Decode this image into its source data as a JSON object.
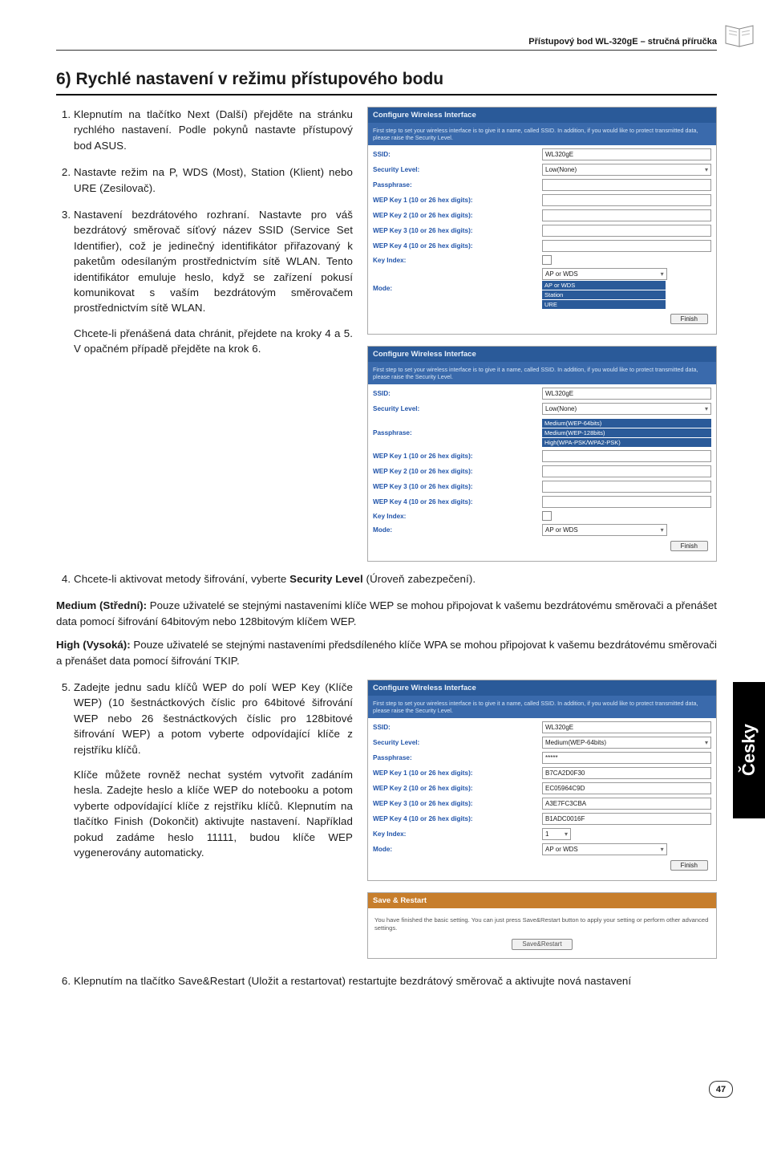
{
  "header": {
    "product": "Přístupový bod WL-320gE – stručná příručka"
  },
  "section": {
    "title": "6) Rychlé nastavení v režimu přístupového bodu"
  },
  "list": {
    "i1": "Klepnutím na tlačítko Next (Další) přejděte na stránku rychlého nastavení. Podle pokynů nastavte přístupový bod ASUS.",
    "i2": "Nastavte režim na P, WDS (Most), Station (Klient) nebo URE (Zesilovač).",
    "i3a": "Nastavení bezdrátového rozhraní. Nastavte pro váš bezdrátový směrovač síťový název SSID (Service Set Identifier), což je jedinečný identifikátor přiřazovaný k paketům odesílaným prostřednictvím sítě WLAN. Tento identifikátor emuluje heslo, když se zařízení pokusí komunikovat s vaším bezdrátovým směrovačem prostřednictvím sítě WLAN.",
    "i3b": "Chcete-li přenášená data chránit, přejdete na kroky 4 a 5. V opačném případě přejděte na krok 6.",
    "i4a": "Chcete-li aktivovat metody šifrování, vyberte ",
    "i4b": "Security Level",
    "i4c": " (Úroveň zabezpečení).",
    "i5a": "Zadejte jednu sadu klíčů WEP do polí WEP Key (Klíče WEP) (10 šestnáctkových číslic pro 64bitové šifrování WEP nebo 26 šestnáctkových číslic pro 128bitové šifrování WEP) a potom vyberte odpovídající klíče z rejstříku klíčů.",
    "i5b": "Klíče můžete rovněž nechat systém vytvořit zadáním hesla. Zadejte heslo a klíče WEP do notebooku a potom vyberte odpovídající klíče z rejstříku klíčů. Klepnutím na tlačítko Finish (Dokončit) aktivujte nastavení. Například pokud zadáme heslo 11111, budou klíče WEP vygenerovány automaticky.",
    "i6": "Klepnutím na tlačítko Save&Restart (Uložit a restartovat) restartujte bezdrátový směrovač a aktivujte nová nastavení"
  },
  "medium": {
    "label": "Medium (Střední):",
    "text": " Pouze uživatelé se stejnými nastaveními klíče WEP se mohou připojovat k vašemu bezdrátovému směrovači a přenášet data pomocí šifrování 64bitovým nebo 128bitovým klíčem WEP."
  },
  "high": {
    "label": "High (Vysoká):",
    "text": " Pouze uživatelé se stejnými nastaveními předsdíleného klíče WPA se mohou připojovat k vašemu bezdrátovému směrovači a přenášet data pomocí šifrování TKIP."
  },
  "panel": {
    "title": "Configure Wireless Interface",
    "desc": "First step to set your wireless interface is to give it a name, called SSID. In addition, if you would like to protect transmitted data, please raise the Security Level.",
    "ssid_l": "SSID:",
    "ssid_v": "WL320gE",
    "sec_l": "Security Level:",
    "sec_v": "Low(None)",
    "pass_l": "Passphrase:",
    "wep1_l": "WEP Key 1 (10 or 26 hex digits):",
    "wep2_l": "WEP Key 2 (10 or 26 hex digits):",
    "wep3_l": "WEP Key 3 (10 or 26 hex digits):",
    "wep4_l": "WEP Key 4 (10 or 26 hex digits):",
    "key_l": "Key Index:",
    "mode_l": "Mode:",
    "mode_v": "AP or WDS",
    "mode_opt1": "AP or WDS",
    "mode_opt2": "Station",
    "mode_opt3": "URE",
    "finish": "Finish"
  },
  "panel2": {
    "ssid_v": "WL320gE",
    "sec_v": "Low(None)",
    "pass_opt1": "Medium(WEP-64bits)",
    "pass_opt2": "Medium(WEP-128bits)",
    "pass_opt3": "High(WPA-PSK/WPA2-PSK)",
    "mode_v": "AP or WDS"
  },
  "panel3": {
    "ssid_v": "WL320gE",
    "sec_v": "Medium(WEP-64bits)",
    "pass_v": "*****",
    "w1": "B7CA2D0F30",
    "w2": "EC05964C9D",
    "w3": "A3E7FC3CBA",
    "w4": "B1ADC0016F",
    "key_v": "1",
    "mode_v": "AP or WDS"
  },
  "save": {
    "title": "Save & Restart",
    "body": "You have finished the basic setting. You can just press Save&Restart button to apply your setting or perform other advanced settings.",
    "btn": "Save&Restart"
  },
  "tab": "Česky",
  "page": "47"
}
